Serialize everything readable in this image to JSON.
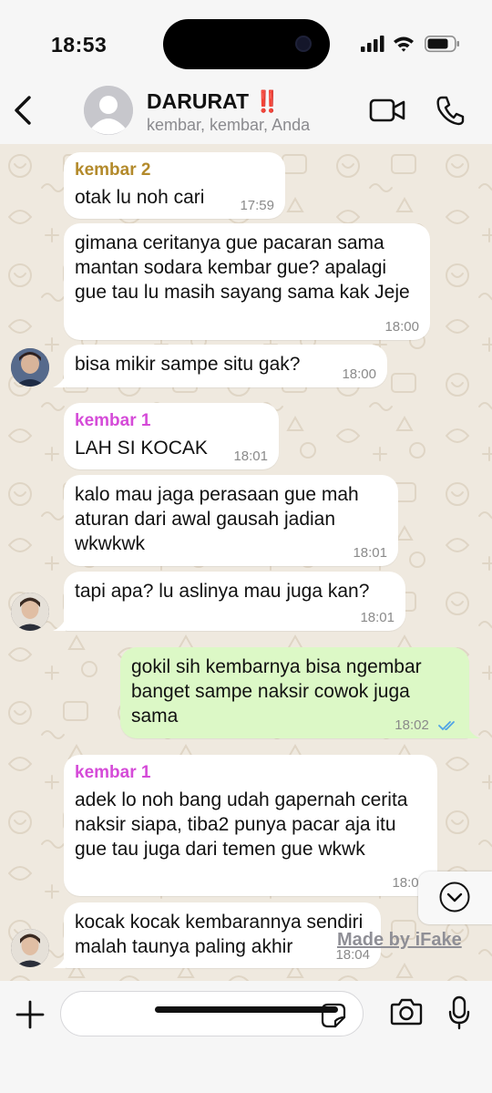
{
  "status_bar": {
    "time": "18:53"
  },
  "header": {
    "title": "DARURAT",
    "title_emoji": "‼️",
    "subtitle": "kembar, kembar, Anda"
  },
  "messages": [
    {
      "sender": "kembar 2",
      "text": "otak lu noh cari",
      "time": "17:59",
      "direction": "in"
    },
    {
      "sender": "",
      "text": "gimana ceritanya gue pacaran sama mantan sodara kembar gue? apalagi gue tau lu masih sayang sama kak Jeje",
      "time": "18:00",
      "direction": "in"
    },
    {
      "sender": "",
      "text": "bisa mikir sampe situ gak?",
      "time": "18:00",
      "direction": "in"
    },
    {
      "sender": "kembar 1",
      "text": "LAH SI KOCAK",
      "time": "18:01",
      "direction": "in"
    },
    {
      "sender": "",
      "text": "kalo mau jaga perasaan gue mah aturan dari awal gausah jadian wkwkwk",
      "time": "18:01",
      "direction": "in"
    },
    {
      "sender": "",
      "text": "tapi apa? lu aslinya mau juga kan?",
      "time": "18:01",
      "direction": "in"
    },
    {
      "sender": "",
      "text": "gokil sih kembarnya bisa ngembar banget sampe naksir cowok juga sama",
      "time": "18:02",
      "direction": "out",
      "status": "read"
    },
    {
      "sender": "kembar 1",
      "text": "adek lo noh bang udah gapernah cerita naksir siapa, tiba2 punya pacar aja itu gue tau juga dari temen gue wkwk",
      "time": "18:03",
      "direction": "in"
    },
    {
      "sender": "",
      "text": "kocak kocak kembarannya sendiri malah taunya paling akhir",
      "time": "18:04",
      "direction": "in"
    }
  ],
  "watermark": "Made by iFake",
  "icons": {
    "back": "chevron-left-icon",
    "video": "video-call-icon",
    "phone": "phone-icon",
    "plus": "plus-icon",
    "sticker": "sticker-icon",
    "camera": "camera-icon",
    "mic": "microphone-icon",
    "scroll": "chevron-down-circle-icon"
  },
  "colors": {
    "kembar_2": "#b38a2b",
    "kembar_1": "#d54bd8",
    "outgoing_bubble": "#dcf8c6",
    "read_ticks": "#4fa3e6"
  }
}
